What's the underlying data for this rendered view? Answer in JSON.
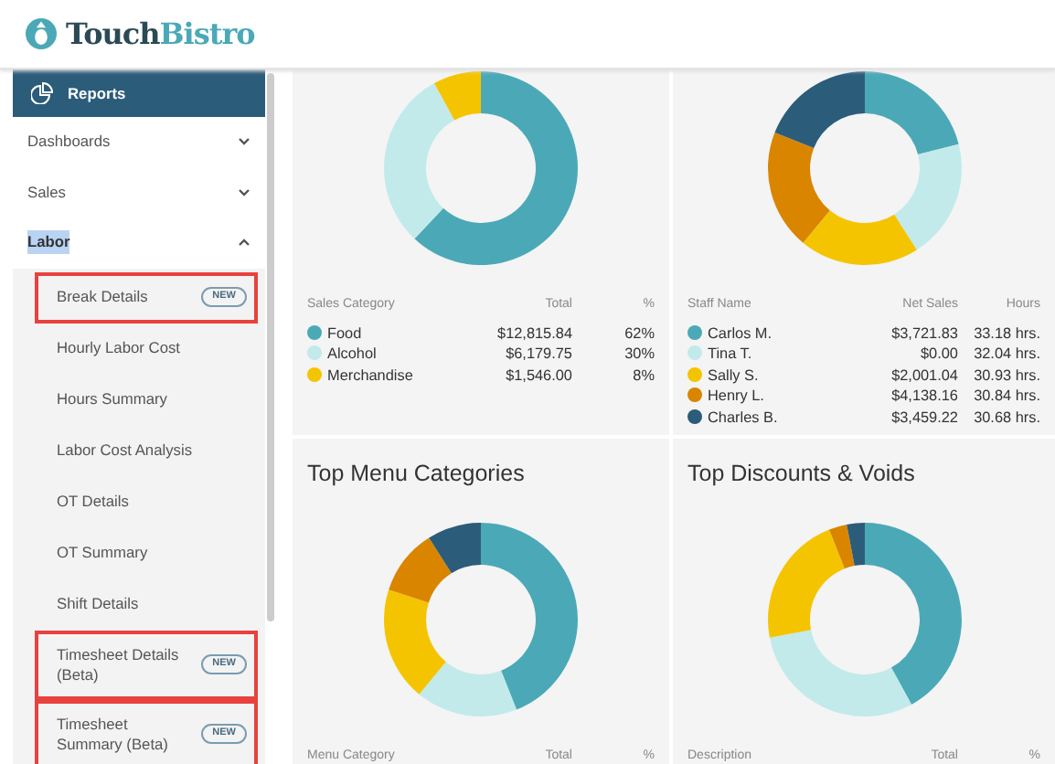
{
  "brand": {
    "first": "Touch",
    "second": "Bistro"
  },
  "sidebar": {
    "header": "Reports",
    "sections": [
      {
        "label": "Dashboards",
        "expanded": false,
        "selected": false
      },
      {
        "label": "Sales",
        "expanded": false,
        "selected": false
      },
      {
        "label": "Labor",
        "expanded": true,
        "selected": true,
        "children": [
          {
            "label": "Break Details",
            "badge": "NEW",
            "highlighted": true
          },
          {
            "label": "Hourly Labor Cost",
            "highlighted": false
          },
          {
            "label": "Hours Summary",
            "highlighted": false
          },
          {
            "label": "Labor Cost Analysis",
            "highlighted": false
          },
          {
            "label": "OT Details",
            "highlighted": false
          },
          {
            "label": "OT Summary",
            "highlighted": false
          },
          {
            "label": "Shift Details",
            "highlighted": false
          },
          {
            "label": "Timesheet Details (Beta)",
            "badge": "NEW",
            "highlighted": true
          },
          {
            "label": "Timesheet Summary (Beta)",
            "badge": "NEW",
            "highlighted": true
          }
        ]
      }
    ]
  },
  "cards": [
    {
      "kind": "picture",
      "columns": [
        "Sales Category",
        "Total",
        "%"
      ],
      "rows": [
        {
          "color": "#4ba9b7",
          "cells": [
            "Food",
            "$12,815.84",
            "62%"
          ]
        },
        {
          "color": "#c2eaea",
          "cells": [
            "Alcohol",
            "$6,179.75",
            "30%"
          ]
        },
        {
          "color": "#f5c400",
          "cells": [
            "Merchandise",
            "$1,546.00",
            "8%"
          ]
        }
      ]
    },
    {
      "kind": "picture",
      "columns": [
        "Staff Name",
        "Net Sales",
        "Hours"
      ],
      "rows": [
        {
          "color": "#4ba9b7",
          "cells": [
            "Carlos M.",
            "$3,721.83",
            "33.18 hrs."
          ]
        },
        {
          "color": "#c2eaea",
          "cells": [
            "Tina T.",
            "$0.00",
            "32.04 hrs."
          ]
        },
        {
          "color": "#f5c400",
          "cells": [
            "Sally S.",
            "$2,001.04",
            "30.93 hrs."
          ]
        },
        {
          "color": "#d98500",
          "cells": [
            "Henry L.",
            "$4,138.16",
            "30.84 hrs."
          ]
        },
        {
          "color": "#2b5c7a",
          "cells": [
            "Charles B.",
            "$3,459.22",
            "30.68 hrs."
          ]
        }
      ]
    },
    {
      "kind": "picture",
      "title": "Top Menu Categories",
      "columns": [
        "Menu Category",
        "Total",
        "%"
      ]
    },
    {
      "kind": "picture",
      "title": "Top Discounts & Voids",
      "columns": [
        "Description",
        "Total",
        "%"
      ]
    }
  ]
}
